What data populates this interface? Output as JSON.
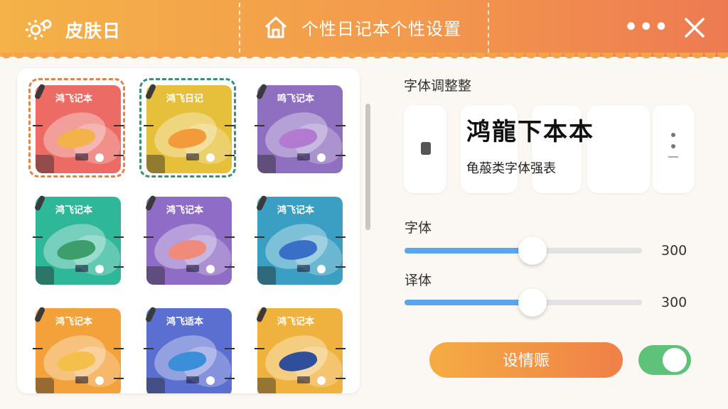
{
  "header": {
    "app_title": "皮肤日",
    "page_title": "个性日记本个性设置",
    "more_label": "•••"
  },
  "skins": [
    {
      "title": "鸿飞记本",
      "bg": "#ec6b64",
      "bird": "#f3b24a",
      "selected": true,
      "ring": "#e0844a"
    },
    {
      "title": "鸿飞日记",
      "bg": "#e6c03a",
      "bird": "#f39a3a",
      "selected": true,
      "ring": "#3a8f74"
    },
    {
      "title": "鸣飞记本",
      "bg": "#8f6fc0",
      "bird": "#b37ad1",
      "selected": false,
      "ring": ""
    },
    {
      "title": "鸿飞记本",
      "bg": "#2fb79a",
      "bird": "#3e9e6b",
      "selected": false,
      "ring": ""
    },
    {
      "title": "鸿飞记本",
      "bg": "#8f6cc6",
      "bird": "#f08a7a",
      "selected": false,
      "ring": ""
    },
    {
      "title": "鸿飞记本",
      "bg": "#3a9fc2",
      "bird": "#3a6fc8",
      "selected": false,
      "ring": ""
    },
    {
      "title": "鸿飞记本",
      "bg": "#f3a13a",
      "bird": "#f5c04a",
      "selected": false,
      "ring": ""
    },
    {
      "title": "鸿飞适本",
      "bg": "#5b6fd1",
      "bird": "#3b8ed8",
      "selected": false,
      "ring": ""
    },
    {
      "title": "鸿飞记本",
      "bg": "#f0b23e",
      "bird": "#2f4f9a",
      "selected": false,
      "ring": ""
    }
  ],
  "font_section": {
    "label": "字体调整整",
    "preview_big": "鸿龍下本本",
    "preview_small": "龟蒰类字体强表"
  },
  "sliders": [
    {
      "label": "字体",
      "value": "300",
      "level": 0.54
    },
    {
      "label": "译体",
      "value": "300",
      "level": 0.54
    }
  ],
  "apply_button": "设情赈",
  "toggle_on": true,
  "colors": {
    "accent": "#f39a4c",
    "slider_fill": "#5aa6ec",
    "toggle_on": "#5fc27b"
  }
}
